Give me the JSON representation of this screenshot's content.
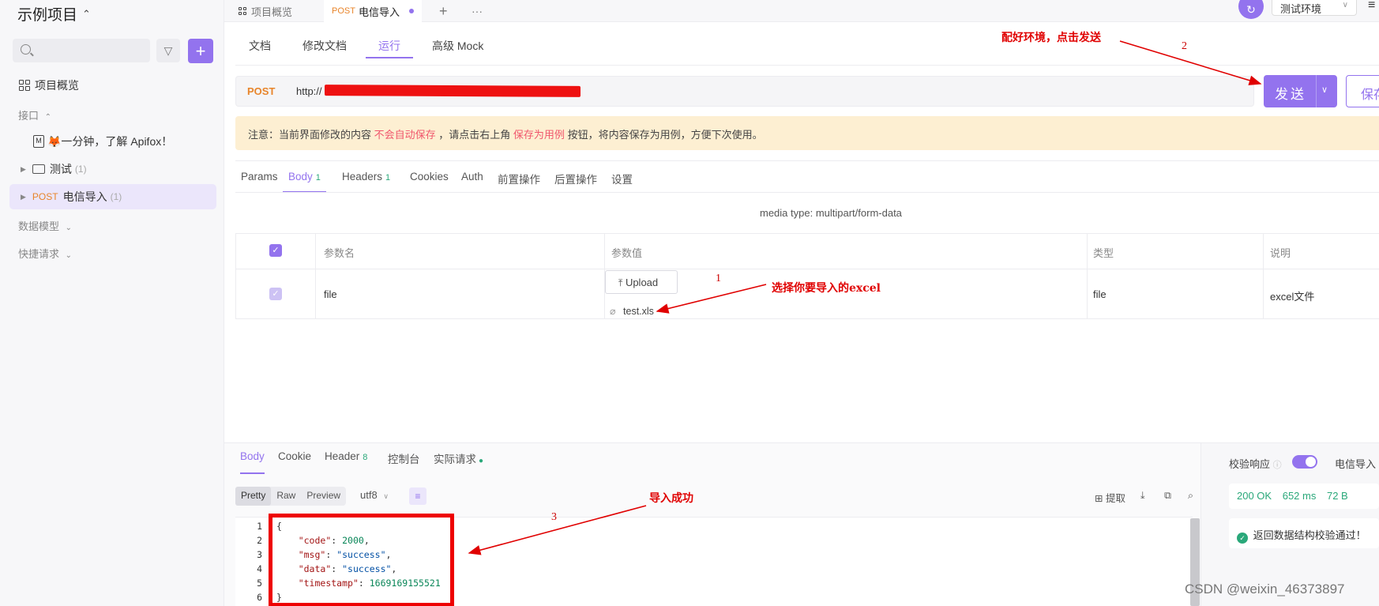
{
  "sidebar": {
    "project_title": "示例项目",
    "items": [
      {
        "label": "项目概览"
      },
      {
        "label": "接口"
      },
      {
        "label": "🦊一分钟，了解 Apifox！"
      },
      {
        "label": "测试",
        "count": "(1)"
      },
      {
        "method": "POST",
        "label": "电信导入",
        "count": "(1)"
      },
      {
        "label": "数据模型"
      },
      {
        "label": "快捷请求"
      }
    ]
  },
  "top_tabs": [
    {
      "label": "项目概览"
    },
    {
      "method": "POST",
      "label": "电信导入"
    }
  ],
  "environment": "测试环境",
  "sub_tabs": [
    "文档",
    "修改文档",
    "运行",
    "高级 Mock"
  ],
  "request": {
    "method": "POST",
    "url": "http://",
    "send_label": "发送",
    "save_label": "保存"
  },
  "notice": {
    "prefix": "注意：当前界面修改的内容",
    "highlight1": "不会自动保存",
    "mid": "，请点击右上角",
    "highlight2": "保存为用例",
    "suffix": "按钮，将内容保存为用例，方便下次使用。"
  },
  "param_tabs": [
    {
      "label": "Params"
    },
    {
      "label": "Body",
      "badge": "1"
    },
    {
      "label": "Headers",
      "badge": "1"
    },
    {
      "label": "Cookies"
    },
    {
      "label": "Auth"
    },
    {
      "label": "前置操作"
    },
    {
      "label": "后置操作"
    },
    {
      "label": "设置"
    }
  ],
  "media_type": "media type: multipart/form-data",
  "table": {
    "headers": [
      "参数名",
      "参数值",
      "类型",
      "说明"
    ],
    "row": {
      "name": "file",
      "upload_label": "Upload",
      "file_name": "test.xls",
      "type": "file",
      "description": "excel文件"
    }
  },
  "response": {
    "tabs": [
      {
        "label": "Body"
      },
      {
        "label": "Cookie"
      },
      {
        "label": "Header",
        "badge": "8"
      },
      {
        "label": "控制台"
      },
      {
        "label": "实际请求"
      }
    ],
    "formats": [
      "Pretty",
      "Raw",
      "Preview"
    ],
    "encoding": "utf8",
    "tools": [
      "提取"
    ],
    "lines": [
      "1",
      "2",
      "3",
      "4",
      "5",
      "6"
    ],
    "json": {
      "code_key": "\"code\"",
      "code_val": "2000",
      "msg_key": "\"msg\"",
      "msg_val": "\"success\"",
      "data_key": "\"data\"",
      "data_val": "\"success\"",
      "ts_key": "\"timestamp\"",
      "ts_val": "1669169155521"
    }
  },
  "right_panel": {
    "validate_label": "校验响应",
    "endpoint_label": "电信导入",
    "status": "200 OK",
    "time": "652 ms",
    "size": "72 B",
    "validation_msg": "返回数据结构校验通过！"
  },
  "annotations": {
    "env_note": "配好环境，点击发送",
    "env_num": "2",
    "excel_note": "选择你要导入的excel",
    "excel_num": "1",
    "success_note": "导入成功",
    "success_num": "3"
  },
  "watermark": "CSDN @weixin_46373897",
  "colors": {
    "accent": "#9373ee",
    "post": "#e8852b",
    "success": "#2aa87a",
    "annotation": "#e00000"
  }
}
